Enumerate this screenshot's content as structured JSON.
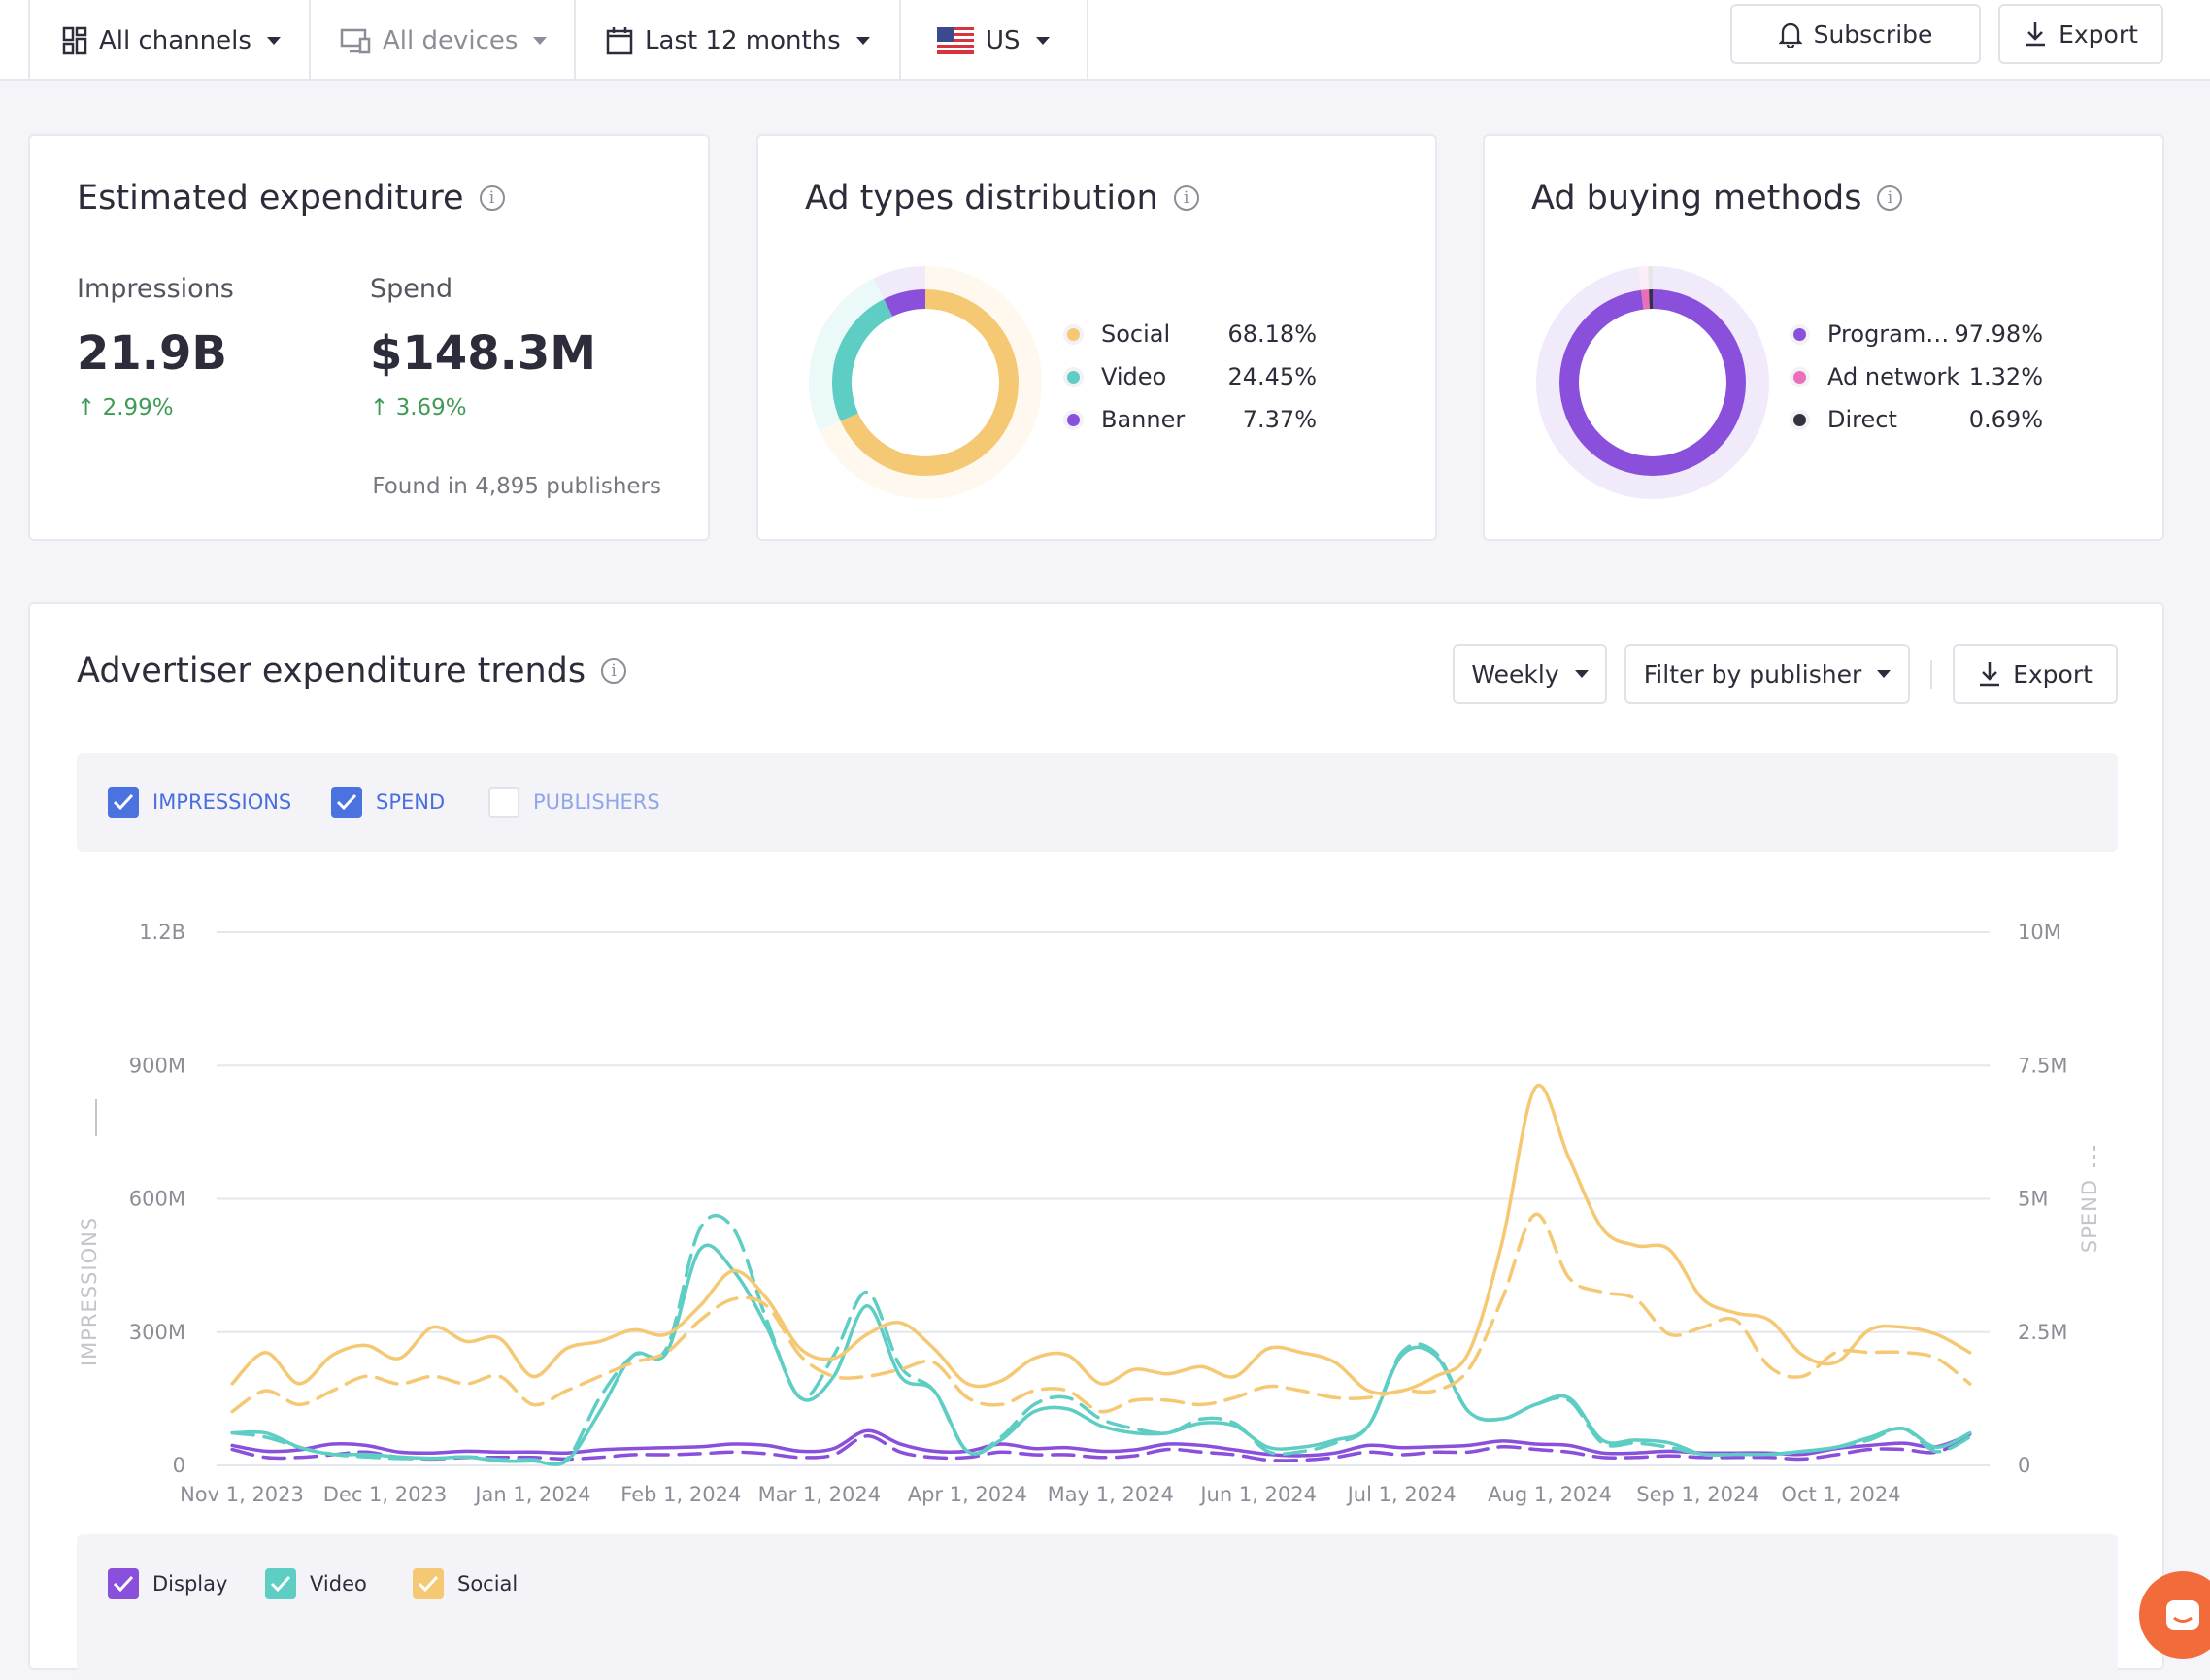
{
  "topbar": {
    "filters": [
      {
        "label": "All channels",
        "icon": "grid-icon"
      },
      {
        "label": "All devices",
        "icon": "devices-icon"
      },
      {
        "label": "Last 12 months",
        "icon": "calendar-icon"
      },
      {
        "label": "US",
        "icon": "us-flag-icon"
      }
    ],
    "subscribe_label": "Subscribe",
    "export_label": "Export"
  },
  "estimated": {
    "title": "Estimated expenditure",
    "impressions_label": "Impressions",
    "impressions_value": "21.9B",
    "impressions_change": "2.99%",
    "spend_label": "Spend",
    "spend_value": "$148.3M",
    "spend_change": "3.69%",
    "footer": "Found in 4,895 publishers"
  },
  "ad_types": {
    "title": "Ad types distribution",
    "items": [
      {
        "label": "Social",
        "pct": "68.18%",
        "value": 68.18,
        "color": "#f5c874"
      },
      {
        "label": "Video",
        "pct": "24.45%",
        "value": 24.45,
        "color": "#5ecdc4"
      },
      {
        "label": "Banner",
        "pct": "7.37%",
        "value": 7.37,
        "color": "#8a4fdb"
      }
    ]
  },
  "buying": {
    "title": "Ad buying methods",
    "items": [
      {
        "label": "Program…",
        "pct": "97.98%",
        "value": 97.98,
        "color": "#8a4fdb"
      },
      {
        "label": "Ad network",
        "pct": "1.32%",
        "value": 1.32,
        "color": "#e86fb8"
      },
      {
        "label": "Direct",
        "pct": "0.69%",
        "value": 0.69,
        "color": "#33333f"
      }
    ]
  },
  "trends": {
    "title": "Advertiser expenditure trends",
    "weekly_label": "Weekly",
    "filter_label": "Filter by publisher",
    "export_label": "Export",
    "metrics": [
      {
        "label": "IMPRESSIONS",
        "checked": true
      },
      {
        "label": "SPEND",
        "checked": true
      },
      {
        "label": "PUBLISHERS",
        "checked": false
      }
    ],
    "legend": [
      {
        "label": "Display",
        "color": "#8a4fdb",
        "checked": true
      },
      {
        "label": "Video",
        "color": "#5ecdc4",
        "checked": true
      },
      {
        "label": "Social",
        "color": "#f5c874",
        "checked": true
      }
    ]
  },
  "chart_data": {
    "type": "line",
    "ylabel": "IMPRESSIONS",
    "y2label": "SPEND",
    "ylim": [
      0,
      1200
    ],
    "y2lim": [
      0,
      10
    ],
    "yticks": [
      "0",
      "300M",
      "600M",
      "900M",
      "1.2B"
    ],
    "y2ticks": [
      "0",
      "2.5M",
      "5M",
      "7.5M",
      "10M"
    ],
    "xticks": [
      "Nov 1, 2023",
      "Dec 1, 2023",
      "Jan 1, 2024",
      "Feb 1, 2024",
      "Mar 1, 2024",
      "Apr 1, 2024",
      "May 1, 2024",
      "Jun 1, 2024",
      "Jul 1, 2024",
      "Aug 1, 2024",
      "Sep 1, 2024",
      "Oct 1, 2024"
    ],
    "xtick_dates": [
      "2023-11-01",
      "2023-12-01",
      "2024-01-01",
      "2024-02-01",
      "2024-03-01",
      "2024-04-01",
      "2024-05-01",
      "2024-06-01",
      "2024-07-01",
      "2024-08-01",
      "2024-09-01",
      "2024-10-01"
    ],
    "x": [
      "2023-10-30",
      "2023-11-06",
      "2023-11-13",
      "2023-11-20",
      "2023-11-27",
      "2023-12-04",
      "2023-12-11",
      "2023-12-18",
      "2023-12-25",
      "2024-01-01",
      "2024-01-08",
      "2024-01-15",
      "2024-01-22",
      "2024-01-29",
      "2024-02-05",
      "2024-02-12",
      "2024-02-19",
      "2024-02-26",
      "2024-03-04",
      "2024-03-11",
      "2024-03-18",
      "2024-03-25",
      "2024-04-01",
      "2024-04-08",
      "2024-04-15",
      "2024-04-22",
      "2024-04-29",
      "2024-05-06",
      "2024-05-13",
      "2024-05-20",
      "2024-05-27",
      "2024-06-03",
      "2024-06-10",
      "2024-06-17",
      "2024-06-24",
      "2024-07-01",
      "2024-07-08",
      "2024-07-15",
      "2024-07-22",
      "2024-07-29",
      "2024-08-05",
      "2024-08-12",
      "2024-08-19",
      "2024-08-26",
      "2024-09-02",
      "2024-09-09",
      "2024-09-16",
      "2024-09-23",
      "2024-09-30",
      "2024-10-07",
      "2024-10-14",
      "2024-10-21",
      "2024-10-28"
    ],
    "series": [
      {
        "name": "Display",
        "metric": "impressions",
        "axis": "left",
        "color": "#8a4fdb",
        "values": [
          45,
          32,
          35,
          48,
          45,
          30,
          28,
          32,
          30,
          30,
          28,
          35,
          38,
          40,
          42,
          48,
          45,
          32,
          38,
          78,
          48,
          32,
          32,
          48,
          38,
          40,
          32,
          35,
          48,
          45,
          35,
          25,
          22,
          28,
          45,
          40,
          42,
          45,
          55,
          48,
          45,
          28,
          28,
          32,
          28,
          28,
          28,
          25,
          38,
          45,
          50,
          42,
          70
        ]
      },
      {
        "name": "Display",
        "metric": "spend",
        "axis": "right",
        "color": "#8a4fdb",
        "values": [
          0.3,
          0.15,
          0.15,
          0.2,
          0.25,
          0.15,
          0.12,
          0.15,
          0.15,
          0.15,
          0.12,
          0.15,
          0.2,
          0.2,
          0.22,
          0.25,
          0.22,
          0.15,
          0.2,
          0.55,
          0.25,
          0.15,
          0.15,
          0.25,
          0.2,
          0.2,
          0.15,
          0.18,
          0.3,
          0.25,
          0.2,
          0.1,
          0.1,
          0.15,
          0.25,
          0.2,
          0.25,
          0.25,
          0.35,
          0.3,
          0.25,
          0.15,
          0.15,
          0.18,
          0.15,
          0.15,
          0.15,
          0.12,
          0.2,
          0.3,
          0.3,
          0.25,
          0.55
        ]
      },
      {
        "name": "Video",
        "metric": "impressions",
        "axis": "left",
        "color": "#5ecdc4",
        "values": [
          73,
          73,
          41,
          25,
          25,
          19,
          16,
          19,
          10,
          10,
          10,
          121,
          248,
          254,
          486,
          438,
          311,
          152,
          200,
          359,
          200,
          168,
          32,
          57,
          121,
          127,
          89,
          73,
          73,
          95,
          89,
          41,
          41,
          57,
          89,
          248,
          248,
          121,
          105,
          137,
          152,
          57,
          57,
          51,
          25,
          25,
          25,
          32,
          41,
          63,
          83,
          41,
          73
        ]
      },
      {
        "name": "Video",
        "metric": "spend",
        "axis": "right",
        "color": "#5ecdc4",
        "values": [
          0.61,
          0.53,
          0.34,
          0.21,
          0.16,
          0.13,
          0.13,
          0.16,
          0.11,
          0.11,
          0.11,
          1.27,
          2.06,
          2.2,
          4.44,
          4.44,
          2.72,
          1.27,
          2.06,
          3.25,
          1.85,
          1.4,
          0.26,
          0.53,
          1.14,
          1.27,
          0.87,
          0.69,
          0.61,
          0.87,
          0.79,
          0.26,
          0.26,
          0.42,
          0.74,
          2.12,
          2.12,
          1.01,
          0.87,
          1.14,
          1.22,
          0.42,
          0.42,
          0.34,
          0.21,
          0.21,
          0.21,
          0.26,
          0.34,
          0.48,
          0.69,
          0.26,
          0.53
        ]
      },
      {
        "name": "Social",
        "metric": "impressions",
        "axis": "left",
        "color": "#f5c874",
        "values": [
          184,
          254,
          184,
          248,
          270,
          241,
          311,
          279,
          286,
          200,
          263,
          279,
          305,
          295,
          359,
          438,
          375,
          263,
          241,
          295,
          321,
          263,
          184,
          190,
          241,
          248,
          184,
          216,
          206,
          222,
          200,
          263,
          254,
          232,
          168,
          168,
          200,
          254,
          502,
          851,
          692,
          533,
          495,
          486,
          375,
          343,
          327,
          248,
          232,
          305,
          311,
          295,
          254
        ]
      },
      {
        "name": "Social",
        "metric": "spend",
        "axis": "right",
        "color": "#f5c874",
        "values": [
          1.01,
          1.4,
          1.14,
          1.4,
          1.67,
          1.53,
          1.67,
          1.53,
          1.67,
          1.14,
          1.4,
          1.67,
          1.93,
          2.12,
          2.72,
          3.12,
          2.99,
          2.06,
          1.67,
          1.67,
          1.8,
          1.93,
          1.27,
          1.14,
          1.4,
          1.4,
          1.01,
          1.22,
          1.22,
          1.14,
          1.27,
          1.48,
          1.4,
          1.27,
          1.27,
          1.4,
          1.4,
          1.8,
          3.12,
          4.71,
          3.52,
          3.25,
          3.12,
          2.46,
          2.59,
          2.72,
          1.85,
          1.67,
          2.12,
          2.12,
          2.12,
          2.01,
          1.53
        ]
      }
    ],
    "grid": true,
    "legend": "bottom-left"
  }
}
